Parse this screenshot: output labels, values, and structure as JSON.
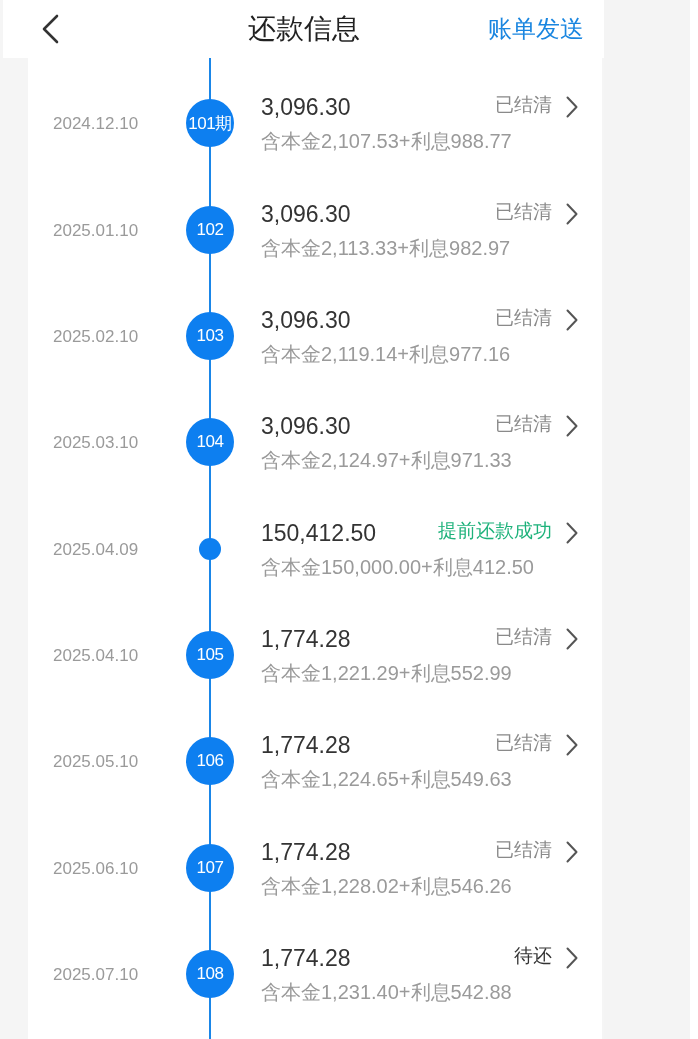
{
  "header": {
    "title": "还款信息",
    "action": "账单发送"
  },
  "installments": [
    {
      "date": "2024.12.10",
      "kind": "numbered",
      "marker": "101期",
      "amount": "3,096.30",
      "detail": "含本金2,107.53+利息988.77",
      "status": {
        "text": "已结清",
        "kind": "settled"
      }
    },
    {
      "date": "2025.01.10",
      "kind": "numbered",
      "marker": "102",
      "amount": "3,096.30",
      "detail": "含本金2,113.33+利息982.97",
      "status": {
        "text": "已结清",
        "kind": "settled"
      }
    },
    {
      "date": "2025.02.10",
      "kind": "numbered",
      "marker": "103",
      "amount": "3,096.30",
      "detail": "含本金2,119.14+利息977.16",
      "status": {
        "text": "已结清",
        "kind": "settled"
      }
    },
    {
      "date": "2025.03.10",
      "kind": "numbered",
      "marker": "104",
      "amount": "3,096.30",
      "detail": "含本金2,124.97+利息971.33",
      "status": {
        "text": "已结清",
        "kind": "settled"
      }
    },
    {
      "date": "2025.04.09",
      "kind": "dot",
      "amount": "150,412.50",
      "detail": "含本金150,000.00+利息412.50",
      "status": {
        "text": "提前还款成功",
        "kind": "success"
      }
    },
    {
      "date": "2025.04.10",
      "kind": "numbered",
      "marker": "105",
      "amount": "1,774.28",
      "detail": "含本金1,221.29+利息552.99",
      "status": {
        "text": "已结清",
        "kind": "settled"
      }
    },
    {
      "date": "2025.05.10",
      "kind": "numbered",
      "marker": "106",
      "amount": "1,774.28",
      "detail": "含本金1,224.65+利息549.63",
      "status": {
        "text": "已结清",
        "kind": "settled"
      }
    },
    {
      "date": "2025.06.10",
      "kind": "numbered",
      "marker": "107",
      "amount": "1,774.28",
      "detail": "含本金1,228.02+利息546.26",
      "status": {
        "text": "已结清",
        "kind": "settled"
      }
    },
    {
      "date": "2025.07.10",
      "kind": "numbered",
      "marker": "108",
      "amount": "1,774.28",
      "detail": "含本金1,231.40+利息542.88",
      "status": {
        "text": "待还",
        "kind": "pending"
      }
    }
  ]
}
